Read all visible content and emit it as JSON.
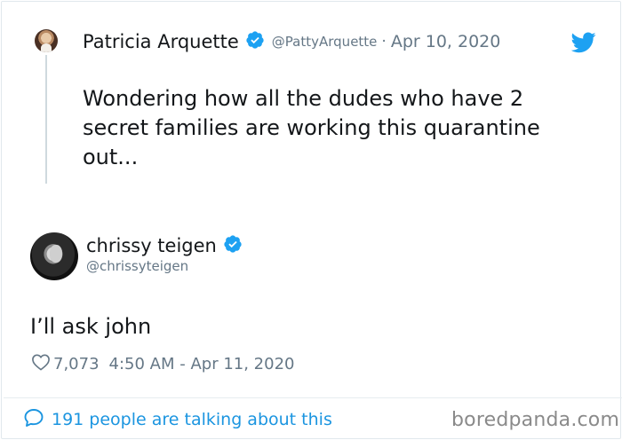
{
  "parent_tweet": {
    "author_name": "Patricia Arquette",
    "handle": "@PattyArquette",
    "separator": "·",
    "date": "Apr 10, 2020",
    "text": "Wondering how all the dudes who have 2 secret families are working this quarantine out..."
  },
  "main_tweet": {
    "author_name": "chrissy teigen",
    "handle": "@chrissyteigen",
    "text": "I’ll ask john",
    "like_count": "7,073",
    "timestamp": "4:50 AM - Apr 11, 2020"
  },
  "footer": {
    "talking_text": "191 people are talking about this"
  },
  "watermark": "boredpanda.com",
  "colors": {
    "verified_blue": "#1da1f2",
    "link_blue": "#1b95e0",
    "muted_gray": "#657786"
  },
  "icons": {
    "verified": "verified-badge-icon",
    "brand": "twitter-bird-icon",
    "like": "heart-outline-icon",
    "reply": "speech-bubble-icon"
  }
}
